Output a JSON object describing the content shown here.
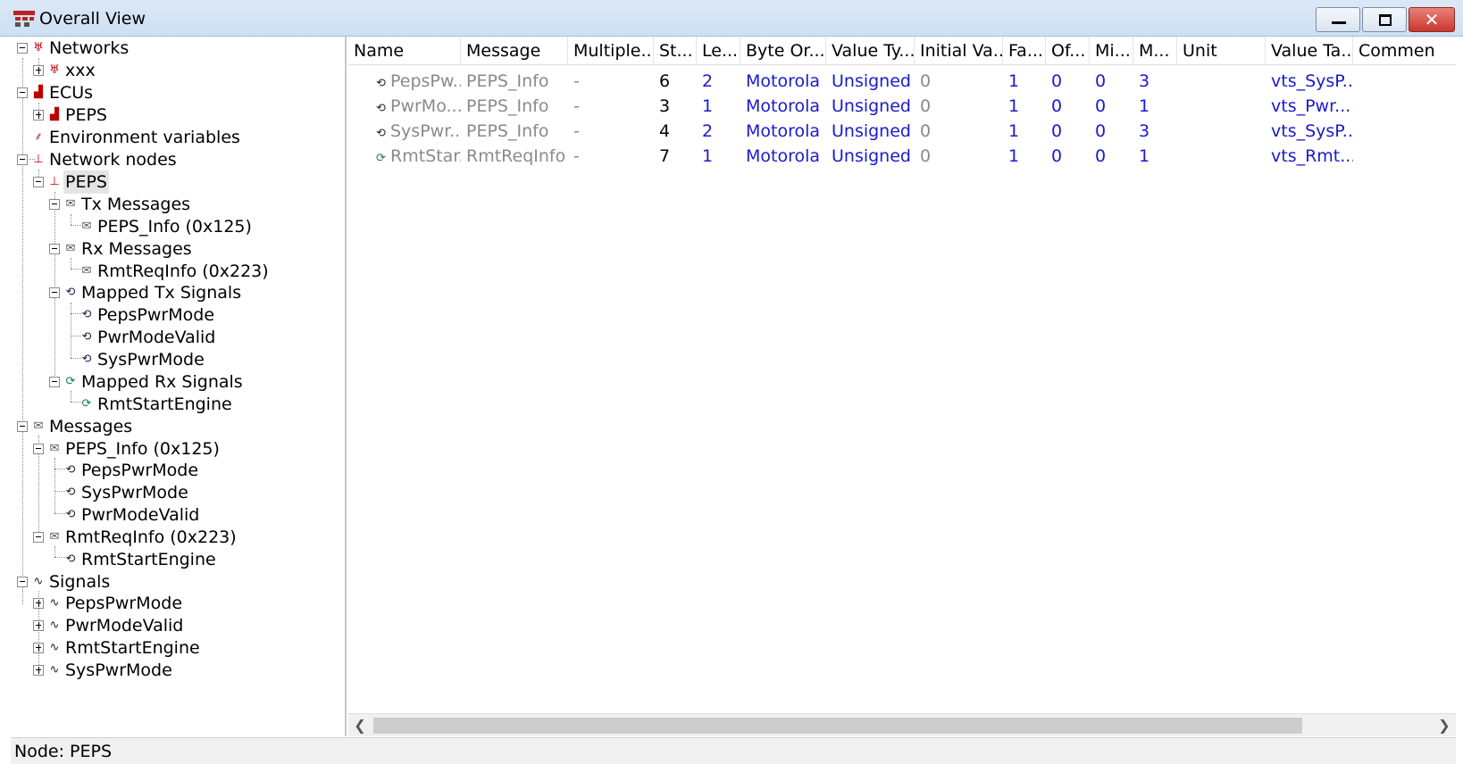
{
  "window": {
    "title": "Overall View"
  },
  "tree": {
    "networks": "Networks",
    "network_xxx": "xxx",
    "ecus": "ECUs",
    "ecu_peps": "PEPS",
    "env_vars": "Environment variables",
    "network_nodes": "Network nodes",
    "node_peps": "PEPS",
    "tx_messages": "Tx Messages",
    "tx_msg_1": "PEPS_Info (0x125)",
    "rx_messages": "Rx Messages",
    "rx_msg_1": "RmtReqInfo (0x223)",
    "mapped_tx": "Mapped Tx Signals",
    "mapped_tx_1": "PepsPwrMode",
    "mapped_tx_2": "PwrModeValid",
    "mapped_tx_3": "SysPwrMode",
    "mapped_rx": "Mapped Rx Signals",
    "mapped_rx_1": "RmtStartEngine",
    "messages": "Messages",
    "msg_peps_info": "PEPS_Info (0x125)",
    "msg_peps_info_s1": "PepsPwrMode",
    "msg_peps_info_s2": "SysPwrMode",
    "msg_peps_info_s3": "PwrModeValid",
    "msg_rmtreq": "RmtReqInfo (0x223)",
    "msg_rmtreq_s1": "RmtStartEngine",
    "signals": "Signals",
    "sig_1": "PepsPwrMode",
    "sig_2": "PwrModeValid",
    "sig_3": "RmtStartEngine",
    "sig_4": "SysPwrMode"
  },
  "grid": {
    "columns": [
      "Name",
      "Message",
      "Multiple...",
      "St...",
      "Le...",
      "Byte Or...",
      "Value Ty...",
      "Initial Va...",
      "Fa...",
      "Of...",
      "Mi...",
      "M...",
      "Unit",
      "Value Ta...",
      "Commen"
    ],
    "rows": [
      [
        "PepsPw...",
        "PEPS_Info",
        "-",
        "6",
        "2",
        "Motorola",
        "Unsigned",
        "0",
        "1",
        "0",
        "0",
        "3",
        "",
        "vts_SysP..."
      ],
      [
        "PwrMo...",
        "PEPS_Info",
        "-",
        "3",
        "1",
        "Motorola",
        "Unsigned",
        "0",
        "1",
        "0",
        "0",
        "1",
        "",
        "vts_Pwr..."
      ],
      [
        "SysPwr...",
        "PEPS_Info",
        "-",
        "4",
        "2",
        "Motorola",
        "Unsigned",
        "0",
        "1",
        "0",
        "0",
        "3",
        "",
        "vts_SysP..."
      ],
      [
        "RmtStar...",
        "RmtReqInfo",
        "-",
        "7",
        "1",
        "Motorola",
        "Unsigned",
        "0",
        "1",
        "0",
        "0",
        "1",
        "",
        "vts_Rmt..."
      ]
    ]
  },
  "status": {
    "text": "Node: PEPS"
  }
}
